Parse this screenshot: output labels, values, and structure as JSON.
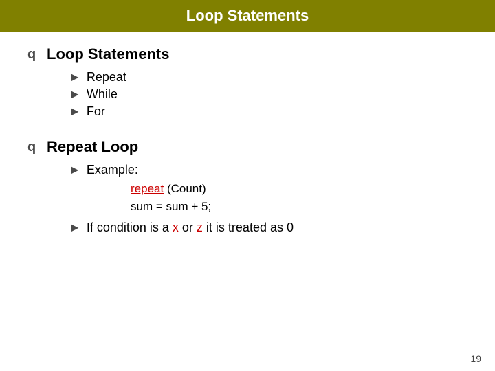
{
  "header": {
    "title": "Loop Statements"
  },
  "sections": [
    {
      "id": "loop-statements",
      "heading": "Loop Statements",
      "sub_items": [
        "Repeat",
        "While",
        "For"
      ]
    },
    {
      "id": "repeat-loop",
      "heading": "Repeat Loop",
      "sub_items": [
        {
          "label": "Example:",
          "code_lines": [
            {
              "prefix": "",
              "keyword": "repeat",
              "suffix": " (Count)"
            },
            {
              "prefix": "sum = sum + 5;",
              "keyword": "",
              "suffix": ""
            }
          ]
        },
        {
          "label_parts": [
            "If condition is a ",
            "x",
            " or ",
            "z",
            " it is treated as 0"
          ]
        }
      ]
    }
  ],
  "page_number": "19"
}
